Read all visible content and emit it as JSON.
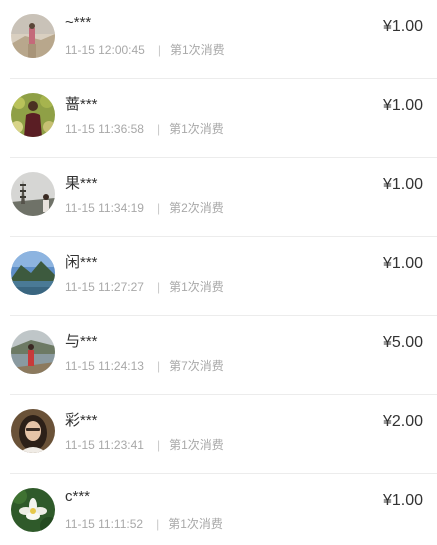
{
  "records": [
    {
      "name": "~***",
      "time": "11-15 12:00:45",
      "count": "第1次消费",
      "amount": "¥1.00",
      "avatar": "person-path-photo"
    },
    {
      "name": "蔷***",
      "time": "11-15 11:36:58",
      "count": "第1次消费",
      "amount": "¥1.00",
      "avatar": "person-garden-photo"
    },
    {
      "name": "果***",
      "time": "11-15 11:34:19",
      "count": "第2次消费",
      "amount": "¥1.00",
      "avatar": "pagoda-photo"
    },
    {
      "name": "闲***",
      "time": "11-15 11:27:27",
      "count": "第1次消费",
      "amount": "¥1.00",
      "avatar": "mountain-lake-photo"
    },
    {
      "name": "与***",
      "time": "11-15 11:24:13",
      "count": "第7次消费",
      "amount": "¥5.00",
      "avatar": "person-river-photo"
    },
    {
      "name": "彩***",
      "time": "11-15 11:23:41",
      "count": "第1次消费",
      "amount": "¥2.00",
      "avatar": "woman-portrait-photo"
    },
    {
      "name": "c***",
      "time": "11-15 11:11:52",
      "count": "第1次消费",
      "amount": "¥1.00",
      "avatar": "lotus-flower-photo"
    }
  ]
}
